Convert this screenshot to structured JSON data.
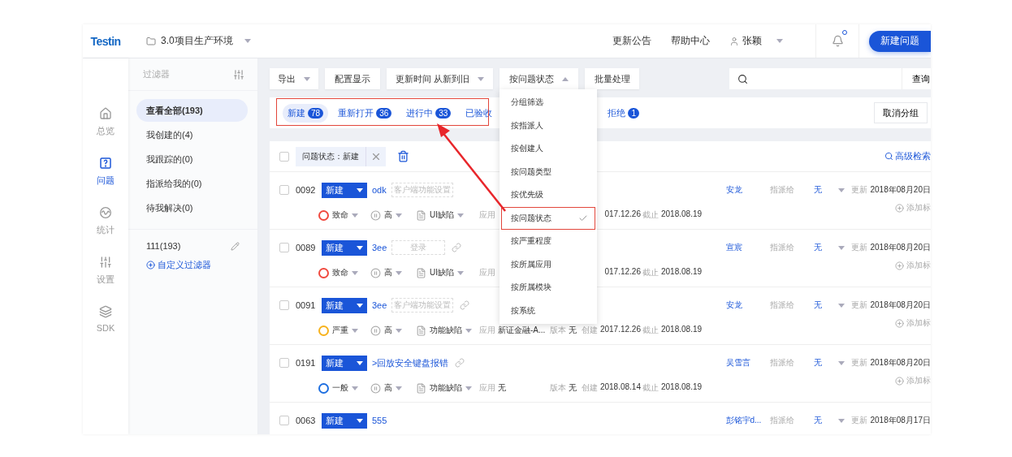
{
  "brand": {
    "logo": "Testin"
  },
  "project": {
    "name": "3.0项目生产环境"
  },
  "header": {
    "links": [
      "更新公告",
      "帮助中心"
    ],
    "user": "张颖",
    "has_unread": true,
    "primary_button": "新建问题"
  },
  "nav": [
    {
      "label": "总览",
      "kind": "home",
      "selected": false
    },
    {
      "label": "问题",
      "kind": "issues",
      "selected": true
    },
    {
      "label": "统计",
      "kind": "stats",
      "selected": false
    },
    {
      "label": "设置",
      "kind": "settings",
      "selected": false
    },
    {
      "label": "SDK",
      "kind": "sdk",
      "selected": false
    }
  ],
  "filters": {
    "title": "过滤器",
    "items": [
      {
        "label": "查看全部(193)",
        "selected": true
      },
      {
        "label": "我创建的(4)",
        "selected": false
      },
      {
        "label": "我跟踪的(0)",
        "selected": false
      },
      {
        "label": "指派给我的(0)",
        "selected": false
      },
      {
        "label": "待我解决(0)",
        "selected": false
      }
    ],
    "custom": [
      {
        "label": "111(193)"
      }
    ],
    "add_label": "自定义过滤器"
  },
  "toolbar": {
    "buttons": [
      {
        "label": "导出",
        "kind": "dropdown",
        "expanded": false
      },
      {
        "label": "配置显示",
        "kind": "plain"
      },
      {
        "label": "更新时间 从新到旧",
        "kind": "dropdown",
        "expanded": false
      },
      {
        "label": "按问题状态",
        "kind": "dropdown",
        "expanded": true
      },
      {
        "label": "批量处理",
        "kind": "plain"
      }
    ],
    "search_button": "查询"
  },
  "group_tabs": [
    {
      "label": "新建",
      "count": "78",
      "selected": true
    },
    {
      "label": "重新打开",
      "count": "36",
      "selected": false
    },
    {
      "label": "进行中",
      "count": "33",
      "selected": false
    },
    {
      "label": "已验收",
      "selected": false
    },
    {
      "label": "拒绝",
      "count": "1",
      "selected": false
    }
  ],
  "ungroup_button": "取消分组",
  "group_menu": [
    {
      "label": "分组筛选",
      "selected": false
    },
    {
      "label": "按指派人",
      "selected": false
    },
    {
      "label": "按创建人",
      "selected": false
    },
    {
      "label": "按问题类型",
      "selected": false
    },
    {
      "label": "按优先级",
      "selected": false
    },
    {
      "label": "按问题状态",
      "selected": true
    },
    {
      "label": "按严重程度",
      "selected": false
    },
    {
      "label": "按所属应用",
      "selected": false
    },
    {
      "label": "按所属模块",
      "selected": false
    },
    {
      "label": "按系统",
      "selected": false
    }
  ],
  "filter_bar": {
    "checked": false,
    "chip": "问题状态：新建",
    "advanced_search": "高级检索"
  },
  "issues": [
    {
      "checked": false,
      "id": "0092",
      "status": "新建",
      "title": "odk",
      "tag": "客户端功能设置",
      "has_link": false,
      "assignee": "安龙",
      "assign_label": "指派给",
      "assign_to": "无",
      "updated_label": "更新",
      "updated": "2018年08月20日",
      "severity": {
        "label": "致命",
        "color": "#f0493e"
      },
      "priority": "高",
      "type": "UI缺陷",
      "app": {
        "label": "应用"
      },
      "created": {
        "value": "017.12.26"
      },
      "deadline": {
        "label": "截止",
        "value": "2018.08.19"
      },
      "add_tag": "添加标"
    },
    {
      "checked": false,
      "id": "0089",
      "status": "新建",
      "title": "3ee",
      "tag": "登录",
      "has_link": true,
      "assignee": "宣宸",
      "assign_label": "指派给",
      "assign_to": "无",
      "updated_label": "更新",
      "updated": "2018年08月20日",
      "severity": {
        "label": "致命",
        "color": "#f0493e"
      },
      "priority": "高",
      "type": "UI缺陷",
      "app": {
        "label": "应用"
      },
      "created": {
        "value": "017.12.26"
      },
      "deadline": {
        "label": "截止",
        "value": "2018.08.19"
      },
      "add_tag": "添加标"
    },
    {
      "checked": false,
      "id": "0091",
      "status": "新建",
      "title": "3ee",
      "tag": "客户端功能设置",
      "has_link": true,
      "assignee": "安龙",
      "assign_label": "指派给",
      "assign_to": "无",
      "updated_label": "更新",
      "updated": "2018年08月20日",
      "severity": {
        "label": "严重",
        "color": "#f7b21c"
      },
      "priority": "高",
      "type": "功能缺陷",
      "app": {
        "label": "应用",
        "value": "新证金融-A..."
      },
      "version": {
        "label": "版本",
        "value": "无"
      },
      "created": {
        "label": "创建",
        "value": "2017.12.26"
      },
      "deadline": {
        "label": "截止",
        "value": "2018.08.19"
      },
      "add_tag": "添加标"
    },
    {
      "checked": false,
      "id": "0191",
      "status": "新建",
      "title": ">回放安全键盘报错",
      "has_link": true,
      "assignee": "吴雪言",
      "assign_label": "指派给",
      "assign_to": "无",
      "updated_label": "更新",
      "updated": "2018年08月20日",
      "severity": {
        "label": "一般",
        "color": "#1e6fe0"
      },
      "priority": "高",
      "type": "功能缺陷",
      "app": {
        "label": "应用",
        "value": "无"
      },
      "version": {
        "label": "版本",
        "value": "无"
      },
      "created": {
        "label": "创建",
        "value": "2018.08.14"
      },
      "deadline": {
        "label": "截止",
        "value": "2018.08.19"
      },
      "add_tag": "添加标"
    },
    {
      "checked": false,
      "id": "0063",
      "status": "新建",
      "title": "555",
      "has_link": false,
      "assignee": "彭铭宇d...",
      "assign_label": "指派给",
      "assign_to": "无",
      "updated_label": "更新",
      "updated": "2018年08月17日"
    }
  ]
}
